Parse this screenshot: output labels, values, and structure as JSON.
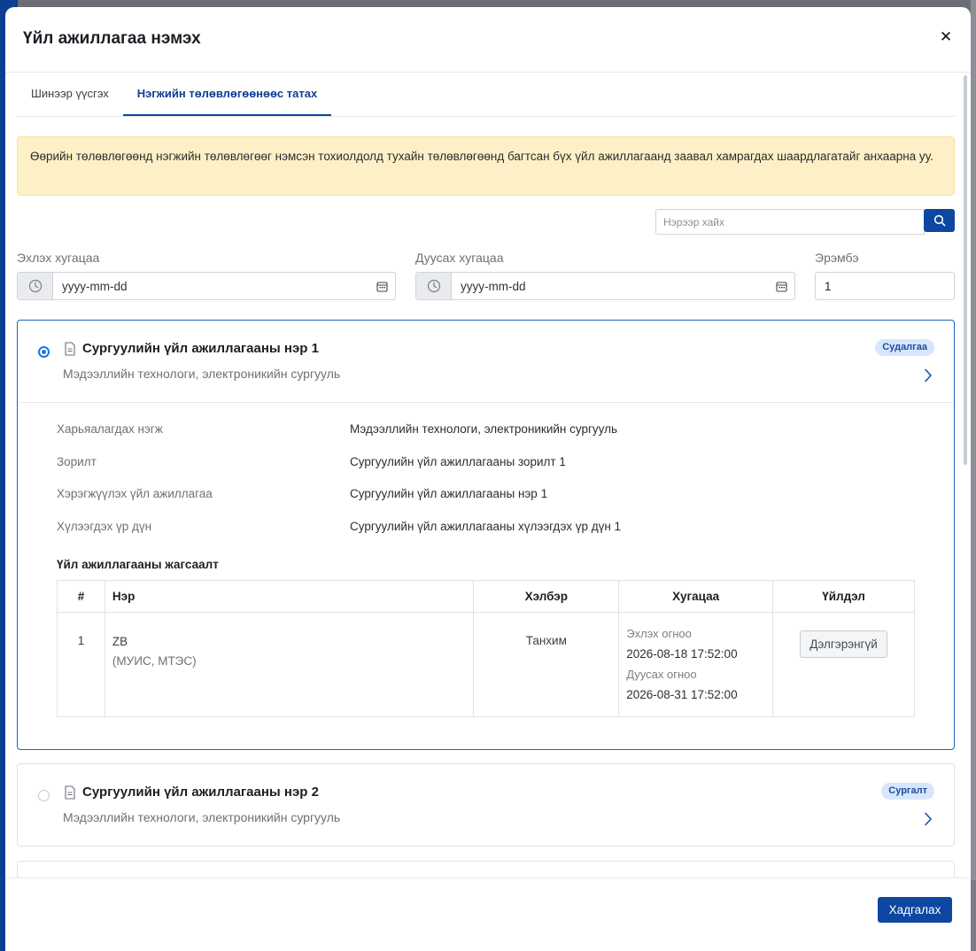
{
  "modal": {
    "title": "Үйл ажиллагаа нэмэх",
    "close_icon": "close-icon"
  },
  "tabs": [
    {
      "label": "Шинээр үүсгэх",
      "active": false
    },
    {
      "label": "Нэгжийн төлөвлөгөөнөөс татах",
      "active": true
    }
  ],
  "alert": {
    "text": "Өөрийн төлөвлөгөөнд нэгжийн төлөвлөгөөг нэмсэн тохиолдолд тухайн төлөвлөгөөнд багтсан бүх үйл ажиллагаанд заавал хамрагдах шаардлагатайг анхаарна уу."
  },
  "search": {
    "placeholder": "Нэрээр хайх",
    "icon": "search-icon"
  },
  "filters": {
    "start_label": "Эхлэх хугацаа",
    "start_placeholder": "yyyy-mm-dd",
    "end_label": "Дуусах хугацаа",
    "end_placeholder": "yyyy-mm-dd",
    "order_label": "Эрэмбэ",
    "order_value": "1"
  },
  "cards": [
    {
      "title": "Сургуулийн үйл ажиллагааны нэр 1",
      "subtitle": "Мэдээллийн технологи, электроникийн сургууль",
      "badge": "Судалгаа",
      "selected": true,
      "details": [
        {
          "label": "Харьяалагдах нэгж",
          "value": "Мэдээллийн технологи, электроникийн сургууль"
        },
        {
          "label": "Зорилт",
          "value": "Сургуулийн үйл ажиллагааны зорилт 1"
        },
        {
          "label": "Хэрэгжүүлэх үйл ажиллагаа",
          "value": "Сургуулийн үйл ажиллагааны нэр 1"
        },
        {
          "label": "Хүлээгдэх үр дүн",
          "value": "Сургуулийн үйл ажиллагааны хүлээгдэх үр дүн 1"
        }
      ],
      "list_title": "Үйл ажиллагааны жагсаалт",
      "table": {
        "headers": [
          "#",
          "Нэр",
          "Хэлбэр",
          "Хугацаа",
          "Үйлдэл"
        ],
        "rows": [
          {
            "num": "1",
            "name": "ZB",
            "name_sub": "(МУИС, МТЭС)",
            "form": "Танхим",
            "start_label": "Эхлэх огноо",
            "start_value": "2026-08-18 17:52:00",
            "end_label": "Дуусах огноо",
            "end_value": "2026-08-31 17:52:00",
            "action": "Дэлгэрэнгүй"
          }
        ]
      }
    },
    {
      "title": "Сургуулийн үйл ажиллагааны нэр 2",
      "subtitle": "Мэдээллийн технологи, электроникийн сургууль",
      "badge": "Сургалт",
      "selected": false
    }
  ],
  "footer": {
    "save_label": "Хадгалах"
  },
  "colors": {
    "primary": "#0d47a1",
    "alert_bg": "#fdf0c7",
    "badge_bg": "#d7e6fb",
    "selected_border": "#1e63c4"
  }
}
